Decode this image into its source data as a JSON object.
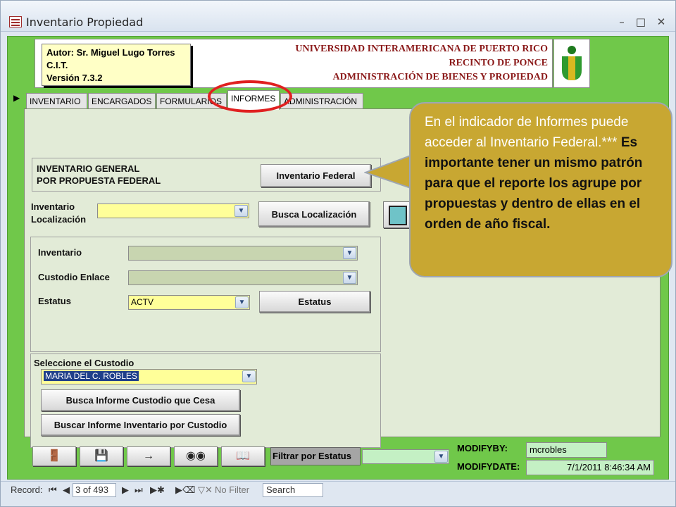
{
  "window": {
    "title": "Inventario Propiedad",
    "controls": [
      "–",
      "□",
      "✕"
    ]
  },
  "header": {
    "author_lines": [
      "Autor:  Sr. Miguel Lugo Torres",
      "C.I.T.",
      "Versión 7.3.2"
    ],
    "university_lines": [
      "UNIVERSIDAD INTERAMERICANA DE PUERTO RICO",
      "RECINTO DE PONCE",
      "ADMINISTRACIÓN DE BIENES Y PROPIEDAD"
    ]
  },
  "tabs": [
    {
      "label": "INVENTARIO"
    },
    {
      "label": "ENCARGADOS"
    },
    {
      "label": "FORMULARIOS"
    },
    {
      "label": "INFORMES",
      "active": true
    },
    {
      "label": "ADMINISTRACIÓN"
    }
  ],
  "federal_group": {
    "label_line1": "INVENTARIO GENERAL",
    "label_line2": "POR PROPUESTA FEDERAL",
    "button": "Inventario Federal"
  },
  "location": {
    "label_line1": "Inventario",
    "label_line2": "Localización",
    "value": "",
    "button": "Busca Localización"
  },
  "filters": {
    "inventario_label": "Inventario",
    "inventario_value": "",
    "custodio_enlace_label": "Custodio Enlace",
    "custodio_enlace_value": "",
    "estatus_label": "Estatus",
    "estatus_value": "ACTV",
    "estatus_button": "Estatus"
  },
  "custodian": {
    "label": "Seleccione el Custodio",
    "value": "MARIA DEL C. ROBLES",
    "button_cesa": "Busca Informe Custodio que Cesa",
    "button_inventario": "Buscar Informe Inventario por Custodio"
  },
  "callout": {
    "plain": "En el indicador de Informes puede acceder al Inventario Federal.*** ",
    "bold": "Es importante tener un mismo patrón para que el reporte los agrupe por propuestas y dentro de ellas en el orden de año fiscal."
  },
  "bottom": {
    "filter_label": "Filtrar por Estatus",
    "filter_value": "",
    "modifyby_label": "MODIFYBY:",
    "modifyby_value": "mcrobles",
    "modifydate_label": "MODIFYDATE:",
    "modifydate_value": "7/1/2011 8:46:34 AM"
  },
  "statusbar": {
    "record_label": "Record:",
    "record_position": "3 of 493",
    "filter_text": "No Filter",
    "search_placeholder": "Search"
  },
  "colors": {
    "canvas_green": "#70c84a",
    "callout_gold": "#c8a732",
    "highlight_red": "#e02020",
    "university_red": "#8b1a1a"
  }
}
